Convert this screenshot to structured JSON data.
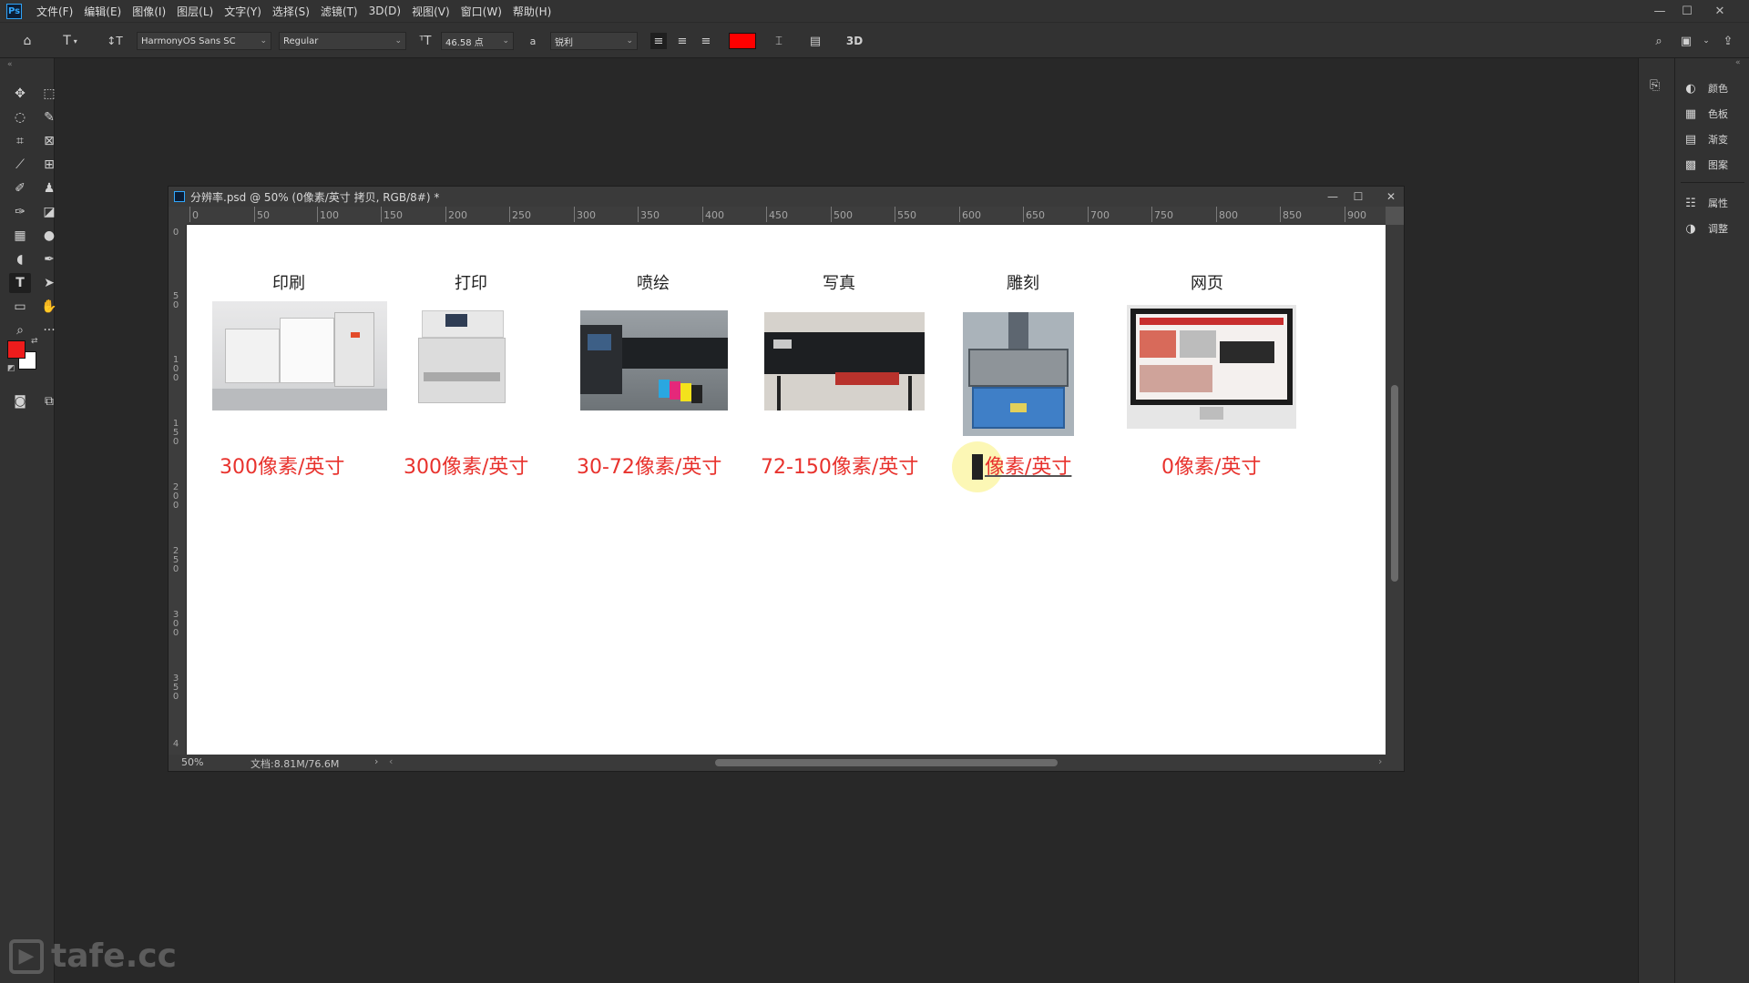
{
  "menu": {
    "items": [
      "文件(F)",
      "编辑(E)",
      "图像(I)",
      "图层(L)",
      "文字(Y)",
      "选择(S)",
      "滤镜(T)",
      "3D(D)",
      "视图(V)",
      "窗口(W)",
      "帮助(H)"
    ],
    "app_logo": "Ps"
  },
  "options": {
    "font_family": "HarmonyOS Sans SC",
    "font_style": "Regular",
    "font_size": "46.58 点",
    "aa_label": "a",
    "antialias": "锐利",
    "three_d": "3D",
    "text_color": "#ff0000"
  },
  "document": {
    "title": "分辨率.psd @ 50% (0像素/英寸 拷贝, RGB/8#) *",
    "zoom": "50%",
    "doc_info": "文档:8.81M/76.6M",
    "ruler_h": [
      "0",
      "50",
      "100",
      "150",
      "200",
      "250",
      "300",
      "350",
      "400",
      "450",
      "500",
      "550",
      "600",
      "650",
      "700",
      "750",
      "800",
      "850",
      "900"
    ],
    "ruler_v": [
      "0",
      "50",
      "100",
      "150",
      "200",
      "250",
      "300",
      "350",
      "4"
    ]
  },
  "canvas": {
    "items": [
      {
        "label": "印刷",
        "resolution": "300像素/英寸"
      },
      {
        "label": "打印",
        "resolution": "300像素/英寸"
      },
      {
        "label": "喷绘",
        "resolution": "30-72像素/英寸"
      },
      {
        "label": "写真",
        "resolution": "72-150像素/英寸"
      },
      {
        "label": "雕刻",
        "resolution": "像素/英寸"
      },
      {
        "label": "网页",
        "resolution": "0像素/英寸"
      }
    ]
  },
  "panels": {
    "items": [
      "颜色",
      "色板",
      "渐变",
      "图案",
      "属性",
      "调整"
    ]
  },
  "colors": {
    "foreground": "#ee1c1c",
    "background": "#ffffff"
  },
  "watermark": "tafe.cc"
}
